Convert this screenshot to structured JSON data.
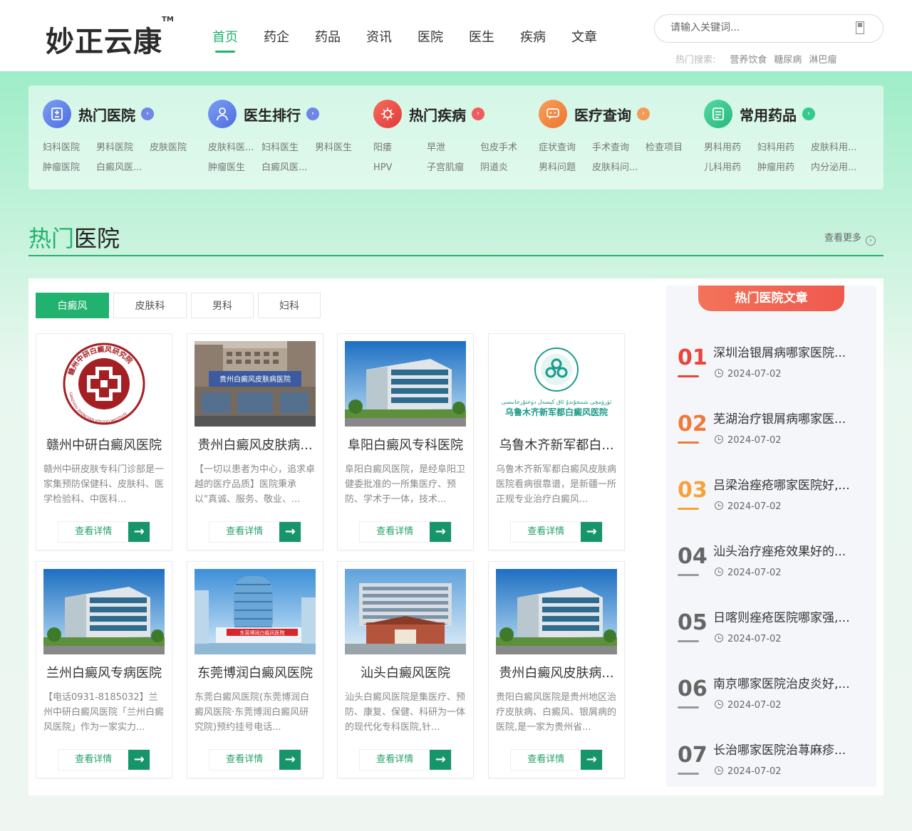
{
  "header": {
    "logo": "妙正云康",
    "logo_tm": "TM",
    "nav": [
      "首页",
      "药企",
      "药品",
      "资讯",
      "医院",
      "医生",
      "疾病",
      "文章"
    ],
    "search_placeholder": "请输入关键词...",
    "hot_search_label": "热门搜索:",
    "hot_keywords": [
      "营养饮食",
      "糖尿病",
      "淋巴瘤"
    ]
  },
  "categories": [
    {
      "title": "热门医院",
      "color": "#5b7be8",
      "links": [
        "妇科医院",
        "男科医院",
        "皮肤医院",
        "肿瘤医院",
        "白癜风医..."
      ]
    },
    {
      "title": "医生排行",
      "color": "#5b7be8",
      "links": [
        "皮肤科医...",
        "妇科医生",
        "男科医生",
        "肿瘤医生",
        "白癜风医..."
      ]
    },
    {
      "title": "热门疾病",
      "color": "#ef4f4f",
      "links": [
        "阳痿",
        "早泄",
        "包皮手术",
        "HPV",
        "子宫肌瘤",
        "阴道炎"
      ]
    },
    {
      "title": "医疗查询",
      "color": "#f28a3a",
      "links": [
        "症状查询",
        "手术查询",
        "检查项目",
        "男科问题",
        "皮肤科问..."
      ]
    },
    {
      "title": "常用药品",
      "color": "#2fc68b",
      "links": [
        "男科用药",
        "妇科用药",
        "皮肤科用...",
        "儿科用药",
        "肿瘤用药",
        "内分泌用..."
      ]
    }
  ],
  "section": {
    "title_hl": "热门",
    "title_rest": "医院",
    "more": "查看更多"
  },
  "tabs": [
    "白癜风",
    "皮肤科",
    "男科",
    "妇科"
  ],
  "hospitals": [
    {
      "name": "赣州中研白癜风医院",
      "desc": "赣州中研皮肤专科门诊部是一家集预防保健科、皮肤科、医学检验科、中医科...",
      "btn": "查看详情"
    },
    {
      "name": "贵州白癜风皮肤病...",
      "desc": "【一切以患者为中心，追求卓越的医疗品质】医院秉承以\"真诚、服务、敬业、...",
      "btn": "查看详情"
    },
    {
      "name": "阜阳白癜风专科医院",
      "desc": "阜阳白癜风医院，是经阜阳卫健委批准的一所集医疗、预防、学术于一体，技术...",
      "btn": "查看详情"
    },
    {
      "name": "乌鲁木齐新军都白...",
      "desc": "乌鲁木齐新军都白癜风皮肤病医院看病很靠谱，是新疆一所正规专业治疗白癜风...",
      "btn": "查看详情"
    },
    {
      "name": "兰州白癜风专病医院",
      "desc": "【电话0931-8185032】兰州中研白癜风医院「兰州白癜风医院」作为一家实力...",
      "btn": "查看详情"
    },
    {
      "name": "东莞博润白癜风医院",
      "desc": "东莞白癜风医院(东莞博润白癜风医院·东莞博润白癜风研究院)预约挂号电话...",
      "btn": "查看详情"
    },
    {
      "name": "汕头白癜风医院",
      "desc": "汕头白癜风医院是集医疗、预防、康复、保健、科研为一体的现代化专科医院,针...",
      "btn": "查看详情"
    },
    {
      "name": "贵州白癜风皮肤病...",
      "desc": "贵阳白癜风医院是贵州地区治疗皮肤病、白癜风、银屑病的医院,是一家为贵州省...",
      "btn": "查看详情"
    }
  ],
  "image_texts": {
    "logo1_ring": "赣州中研白癜风研究院",
    "logo1_en": "GANZHOU ZHONGYAN VITILIGO INSTITUTE",
    "building2_sign": "贵州白癜风皮肤病医院",
    "logo4_name": "乌鲁木齐新军都白癜风医院",
    "building6_sign": "东莞博润白癜风医院"
  },
  "sidebar": {
    "badge": "热门医院文章",
    "articles": [
      {
        "num": "01",
        "title": "深圳治银屑病哪家医院...",
        "date": "2024-07-02",
        "color": "#e8453c"
      },
      {
        "num": "02",
        "title": "芜湖治疗银屑病哪家医...",
        "date": "2024-07-02",
        "color": "#f07a3a"
      },
      {
        "num": "03",
        "title": "吕梁治痤疮哪家医院好,...",
        "date": "2024-07-02",
        "color": "#f5a23a"
      },
      {
        "num": "04",
        "title": "汕头治疗痤疮效果好的...",
        "date": "2024-07-02",
        "color": "#666666"
      },
      {
        "num": "05",
        "title": "日喀则痤疮医院哪家强,...",
        "date": "2024-07-02",
        "color": "#666666"
      },
      {
        "num": "06",
        "title": "南京哪家医院治皮炎好,...",
        "date": "2024-07-02",
        "color": "#666666"
      },
      {
        "num": "07",
        "title": "长治哪家医院治荨麻疹...",
        "date": "2024-07-02",
        "color": "#666666"
      }
    ]
  }
}
